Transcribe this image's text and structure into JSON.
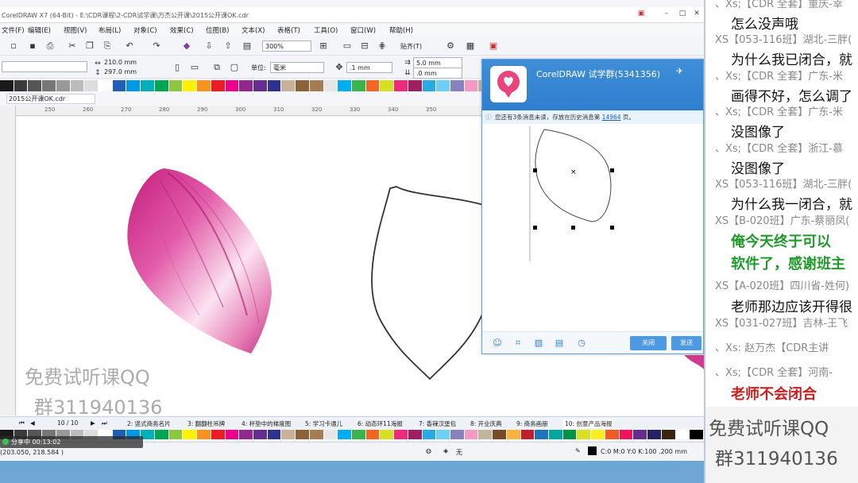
{
  "window": {
    "title": "CorelDRAW X7 (64-Bit) - E:\\CDR课程\\2-CDR试学课\\万杰公开课\\2015公开课OK.cdr"
  },
  "menu": [
    "文件(F)",
    "编辑(E)",
    "视图(V)",
    "布局(L)",
    "对象(C)",
    "效果(C)",
    "位图(B)",
    "文本(X)",
    "表格(T)",
    "工具(O)",
    "窗口(W)",
    "帮助(H)"
  ],
  "toolbar": {
    "zoom": "300%",
    "snap": "贴齐(T)"
  },
  "propbar": {
    "width": "210.0 mm",
    "height": "297.0 mm",
    "unit_label": "单位:",
    "unit": "毫米",
    "nudge": ".1 mm",
    "dup_x": "5.0 mm",
    "dup_y": ".0 mm"
  },
  "document_tab": "2015公开课OK.cdr",
  "ruler_ticks": [
    "250",
    "260",
    "270",
    "280",
    "290",
    "300",
    "310",
    "320",
    "330",
    "340",
    "350"
  ],
  "pagebar": {
    "page_counter": "10 / 10",
    "pages": [
      "2: 竖式商务名片",
      "3: 翻翻柱吊牌",
      "4: 杯垫中的梯度图",
      "5: 学习卡通儿",
      "6: 动态环11海报",
      "7: 香辣汉堡包",
      "8: 开业庆典",
      "9: 商务画册",
      "10: 创意产品海报"
    ]
  },
  "recorder": {
    "text": "分享中 00:13:02"
  },
  "status": {
    "coords": "(203.050, 218.584 )",
    "fill_none": "无",
    "outline": "C:0 M:0 Y:0 K:100  .200 mm"
  },
  "watermark": {
    "line1": "免费试听课QQ",
    "line2": "群311940136"
  },
  "qq": {
    "title": "CorelDRAW 试学群(5341356)",
    "notice_prefix": "您还有3条消息未读，存放在历史消息第",
    "notice_page": "14964",
    "notice_suffix": "页。",
    "close_label": "关闭",
    "send_label": "发送"
  },
  "chat": [
    {
      "type": "sender",
      "text": "、Xs;【CDR 全套】重庆-幸"
    },
    {
      "type": "msg",
      "text": "怎么没声哦"
    },
    {
      "type": "sender",
      "text": "XS【053-116班】湖北-三胖("
    },
    {
      "type": "msg",
      "text": "为什么我已闭合，就"
    },
    {
      "type": "sender",
      "text": "、Xs;【CDR 全套】广东-米"
    },
    {
      "type": "msg",
      "text": "画得不好，怎么调了"
    },
    {
      "type": "sender",
      "text": "、Xs;【CDR 全套】广东-米"
    },
    {
      "type": "msg",
      "text": "没图像了"
    },
    {
      "type": "sender",
      "text": "、Xs;【CDR 全套】浙江-慕"
    },
    {
      "type": "msg",
      "text": "没图像了"
    },
    {
      "type": "sender",
      "text": "XS【053-116班】湖北-三胖("
    },
    {
      "type": "msg",
      "text": "为什么我一闭合，就"
    },
    {
      "type": "sender",
      "text": "XS【B-020班】广东-蔡丽凤("
    },
    {
      "type": "green",
      "text": "俺今天终于可以"
    },
    {
      "type": "green",
      "text": "软件了，感谢班主"
    },
    {
      "type": "sender",
      "text": "XS【A-020班】四川省-姓何)"
    },
    {
      "type": "msg",
      "text": "老师那边应该开得很"
    },
    {
      "type": "sender",
      "text": "XS【031-027班】吉林-王飞 "
    },
    {
      "type": "sender",
      "text": "、Xs: 赵万杰【CDR主讲"
    },
    {
      "type": "sender",
      "text": "、Xs;【CDR 全套】河南-"
    },
    {
      "type": "red",
      "text": "老师不会闭合"
    }
  ],
  "colors": {
    "titlebar_blue": "#3f8ed8",
    "petal_pink": "#d8358f",
    "chat_green": "#1f9a2a",
    "chat_red": "#cc1e1e"
  }
}
